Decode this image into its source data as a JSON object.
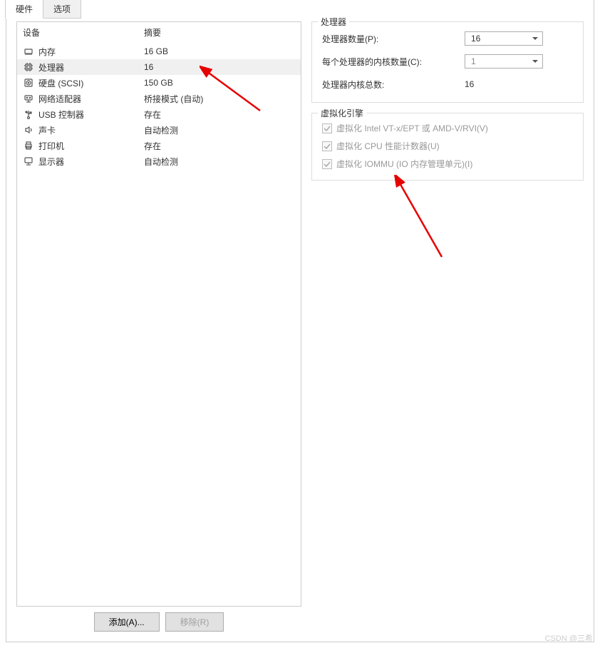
{
  "tabs": {
    "hardware": "硬件",
    "options": "选项"
  },
  "headers": {
    "device": "设备",
    "summary": "摘要"
  },
  "hw": [
    {
      "icon": "memory",
      "device": "内存",
      "summary": "16 GB",
      "selected": false
    },
    {
      "icon": "cpu",
      "device": "处理器",
      "summary": "16",
      "selected": true
    },
    {
      "icon": "disk",
      "device": "硬盘 (SCSI)",
      "summary": "150 GB",
      "selected": false
    },
    {
      "icon": "network",
      "device": "网络适配器",
      "summary": "桥接模式 (自动)",
      "selected": false
    },
    {
      "icon": "usb",
      "device": "USB 控制器",
      "summary": "存在",
      "selected": false
    },
    {
      "icon": "sound",
      "device": "声卡",
      "summary": "自动检测",
      "selected": false
    },
    {
      "icon": "printer",
      "device": "打印机",
      "summary": "存在",
      "selected": false
    },
    {
      "icon": "display",
      "device": "显示器",
      "summary": "自动检测",
      "selected": false
    }
  ],
  "buttons": {
    "add": "添加(A)...",
    "remove": "移除(R)"
  },
  "processor_group": {
    "title": "处理器",
    "num_processors_label": "处理器数量(P):",
    "num_processors_value": "16",
    "cores_per_label": "每个处理器的内核数量(C):",
    "cores_per_value": "1",
    "total_label": "处理器内核总数:",
    "total_value": "16"
  },
  "virt_group": {
    "title": "虚拟化引擎",
    "vt_x": "虚拟化 Intel VT-x/EPT 或 AMD-V/RVI(V)",
    "cpu_perf": "虚拟化 CPU 性能计数器(U)",
    "iommu": "虚拟化 IOMMU (IO 内存管理单元)(I)"
  },
  "watermark": "CSDN @三希"
}
